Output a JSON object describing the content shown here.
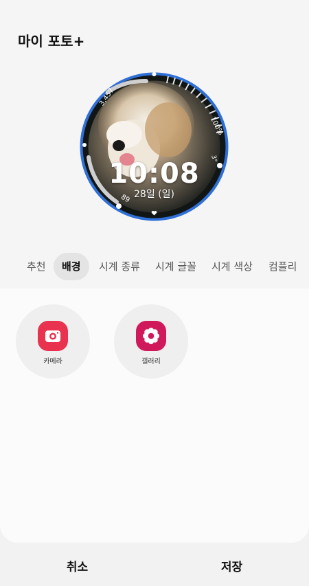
{
  "page": {
    "title": "마이 포토+"
  },
  "watch_face": {
    "time": "10:08",
    "date": "28일 (일)",
    "steps": "3,457",
    "battery": "100%",
    "heart_rate": "89",
    "weather": "3°",
    "accent_color": "#2f6fd6"
  },
  "tabs": [
    {
      "label": "추천"
    },
    {
      "label": "배경"
    },
    {
      "label": "시계 종류"
    },
    {
      "label": "시계 글꼴"
    },
    {
      "label": "시계 색상"
    },
    {
      "label": "컴플리"
    }
  ],
  "active_tab": "배경",
  "options": [
    {
      "label": "카메라",
      "icon": "camera-icon",
      "color": "#e8324f"
    },
    {
      "label": "갤러리",
      "icon": "flower-icon",
      "color": "#d0195a"
    }
  ],
  "actions": {
    "cancel": "취소",
    "save": "저장"
  }
}
